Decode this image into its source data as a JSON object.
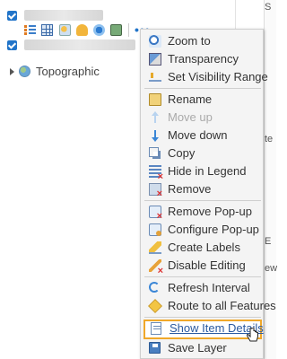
{
  "layers": [
    {
      "visible": true
    },
    {
      "visible": true
    }
  ],
  "layer_tools": [
    "show-legend-icon",
    "show-table-icon",
    "change-style-icon",
    "filter-icon",
    "perform-analysis-icon",
    "save-icon",
    "more-options-icon"
  ],
  "more_label": "•••",
  "basemap": {
    "label": "Topographic",
    "icon": "globe-icon"
  },
  "menu": {
    "items": [
      {
        "label": "Zoom to",
        "icon": "zoom-icon"
      },
      {
        "label": "Transparency",
        "icon": "transparency-icon"
      },
      {
        "label": "Set Visibility Range",
        "icon": "visibility-range-icon"
      },
      {
        "label": "Rename",
        "icon": "rename-icon"
      },
      {
        "label": "Move up",
        "icon": "arrow-up-icon",
        "disabled": true
      },
      {
        "label": "Move down",
        "icon": "arrow-down-icon"
      },
      {
        "label": "Copy",
        "icon": "copy-icon"
      },
      {
        "label": "Hide in Legend",
        "icon": "hide-legend-icon"
      },
      {
        "label": "Remove",
        "icon": "remove-icon"
      },
      {
        "label": "Remove Pop-up",
        "icon": "remove-popup-icon"
      },
      {
        "label": "Configure Pop-up",
        "icon": "configure-popup-icon"
      },
      {
        "label": "Create Labels",
        "icon": "labels-icon"
      },
      {
        "label": "Disable Editing",
        "icon": "disable-editing-icon"
      },
      {
        "label": "Refresh Interval",
        "icon": "refresh-icon"
      },
      {
        "label": "Route to all Features",
        "icon": "route-icon"
      },
      {
        "label": "Show Item Details",
        "icon": "item-details-icon",
        "highlighted": true
      },
      {
        "label": "Save Layer",
        "icon": "save-layer-icon"
      }
    ]
  },
  "map_edge_text": [
    "S",
    "te",
    "E",
    "ew"
  ],
  "colors": {
    "checkbox": "#2174c9",
    "highlight_border": "#f0a82a",
    "menu_bg": "#f4f4f4"
  }
}
